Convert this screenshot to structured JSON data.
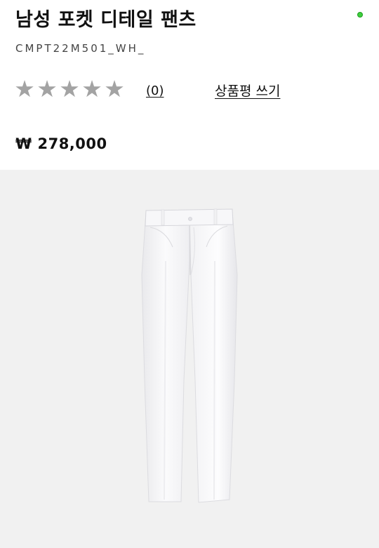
{
  "product": {
    "title": "남성 포켓 디테일 팬츠",
    "sku": "CMPT22M501_WH_",
    "price": "₩ 278,000"
  },
  "rating": {
    "stars_filled": 0,
    "stars_total": 5,
    "star_glyph": "★",
    "review_count": "(0)",
    "write_review_label": "상품평 쓰기"
  },
  "image": {
    "subject": "white-pants"
  },
  "colors": {
    "star_color": "#a3a3a3",
    "status_dot": "#3ecf3e",
    "image_background": "#f1f1f1"
  }
}
